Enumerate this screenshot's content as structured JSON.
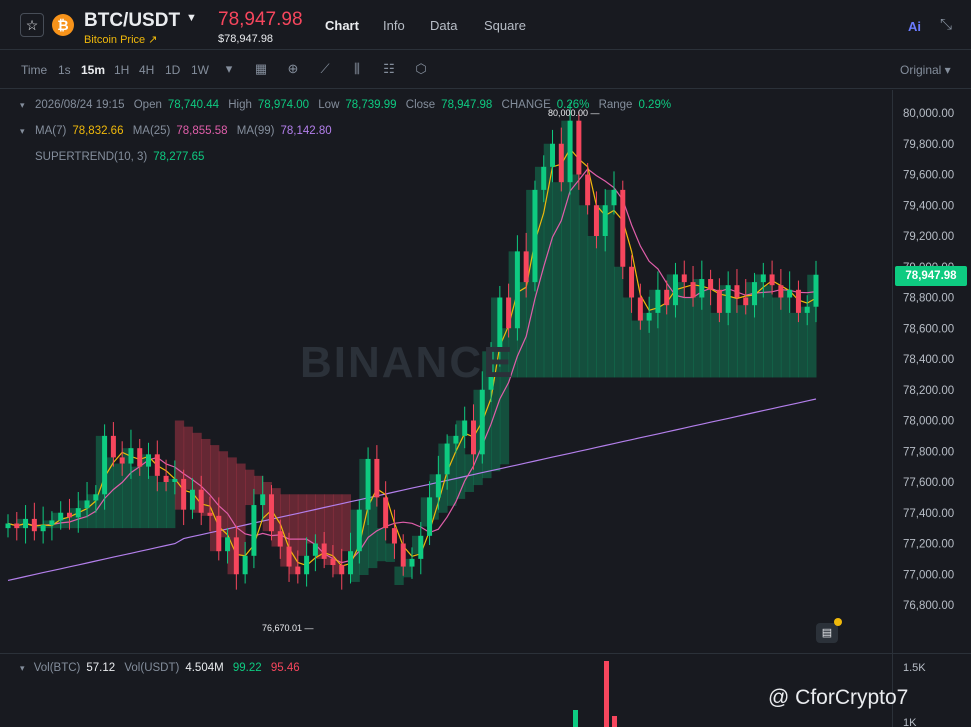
{
  "header": {
    "symbol": "BTC/USDT",
    "coin_glyph": "₿",
    "subtitle": "Bitcoin Price ↗",
    "price": "78,947.98",
    "price_sub": "$78,947.98",
    "tabs": [
      {
        "label": "Chart",
        "active": true
      },
      {
        "label": "Info",
        "active": false
      },
      {
        "label": "Data",
        "active": false
      },
      {
        "label": "Square",
        "active": false
      }
    ],
    "ai_label": "Ai"
  },
  "toolbar": {
    "timeframes": [
      {
        "label": "Time",
        "active": false
      },
      {
        "label": "1s",
        "active": false
      },
      {
        "label": "15m",
        "active": true
      },
      {
        "label": "1H",
        "active": false
      },
      {
        "label": "4H",
        "active": false
      },
      {
        "label": "1D",
        "active": false
      },
      {
        "label": "1W",
        "active": false
      }
    ],
    "original_label": "Original ▾"
  },
  "legend": {
    "ohlc": {
      "date": "2026/08/24 19:15",
      "open_label": "Open",
      "open": "78,740.44",
      "high_label": "High",
      "high": "78,974.00",
      "low_label": "Low",
      "low": "78,739.99",
      "close_label": "Close",
      "close": "78,947.98",
      "change_label": "CHANGE",
      "change": "0.26%",
      "range_label": "Range",
      "range": "0.29%"
    },
    "ma": {
      "ma7_label": "MA(7)",
      "ma7": "78,832.66",
      "ma25_label": "MA(25)",
      "ma25": "78,855.58",
      "ma99_label": "MA(99)",
      "ma99": "78,142.80"
    },
    "supertrend": {
      "label": "SUPERTREND(10, 3)",
      "value": "78,277.65"
    },
    "volume": {
      "vol_btc_label": "Vol(BTC)",
      "vol_btc": "57.12",
      "vol_usdt_label": "Vol(USDT)",
      "vol_usdt": "4.504M",
      "v1": "99.22",
      "v2": "95.46"
    }
  },
  "chart_data": {
    "type": "candlestick",
    "y_ticks": [
      76800,
      77000,
      77200,
      77400,
      77600,
      77800,
      78000,
      78200,
      78400,
      78600,
      78800,
      79000,
      79200,
      79400,
      79600,
      79800,
      80000
    ],
    "y_tick_labels": [
      "76,800.00",
      "77,000.00",
      "77,200.00",
      "77,400.00",
      "77,600.00",
      "77,800.00",
      "78,000.00",
      "78,200.00",
      "78,400.00",
      "78,600.00",
      "78,800.00",
      "79,000.00",
      "79,200.00",
      "79,400.00",
      "79,600.00",
      "79,800.00",
      "80,000.00"
    ],
    "high_annotation": "80,000.00",
    "low_annotation": "76,670.01",
    "last_price_label": "78,947.98",
    "vol_ticks": [
      "1.5K",
      "1K"
    ],
    "watermark": "BINANCE",
    "colors": {
      "up": "#0ecb81",
      "down": "#f6465d",
      "ma7": "#f0b90b",
      "ma25": "#e05eaa",
      "ma99": "#b37feb"
    },
    "close_path": [
      77330,
      77300,
      77360,
      77280,
      77320,
      77350,
      77400,
      77370,
      77430,
      77480,
      77520,
      77900,
      77760,
      77720,
      77820,
      77700,
      77780,
      77640,
      77600,
      77620,
      77420,
      77550,
      77400,
      77380,
      77150,
      77240,
      77000,
      77120,
      77450,
      77520,
      77280,
      77180,
      77050,
      77000,
      77120,
      77200,
      77100,
      77060,
      77000,
      77150,
      77420,
      77750,
      77500,
      77300,
      77200,
      77050,
      77100,
      77250,
      77500,
      77650,
      77850,
      77900,
      78000,
      77780,
      78200,
      78450,
      78800,
      78600,
      79100,
      78900,
      79500,
      79650,
      79800,
      79550,
      79950,
      79600,
      79400,
      79200,
      79400,
      79500,
      79000,
      78800,
      78650,
      78700,
      78850,
      78750,
      78950,
      78900,
      78800,
      78920,
      78850,
      78700,
      78880,
      78800,
      78750,
      78900,
      78950,
      78880,
      78800,
      78850,
      78700,
      78740,
      78948
    ]
  },
  "watermark_author": "@ CforCrypto7"
}
